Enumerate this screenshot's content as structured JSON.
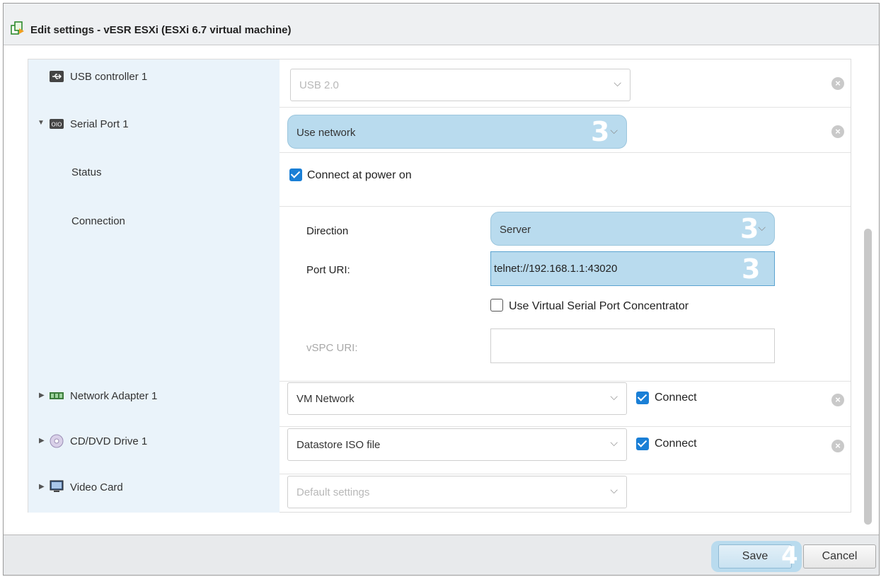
{
  "dialog": {
    "title": "Edit settings - vESR ESXi (ESXi 6.7 virtual machine)"
  },
  "rows": {
    "usb": {
      "label": "USB controller 1",
      "icon": "usb-icon",
      "select_value": "USB 2.0"
    },
    "serial": {
      "label": "Serial Port 1",
      "icon": "serial-port-icon",
      "select_value": "Use network",
      "badge": "3"
    },
    "status": {
      "label": "Status",
      "checkbox_label": "Connect at power on",
      "checked": true
    },
    "connection": {
      "label": "Connection",
      "direction_label": "Direction",
      "direction_value": "Server",
      "direction_badge": "3",
      "port_uri_label": "Port URI:",
      "port_uri_value": "telnet://192.168.1.1:43020",
      "port_uri_badge": "3",
      "vspc_checkbox_label": "Use Virtual Serial Port Concentrator",
      "vspc_checked": false,
      "vspc_uri_label": "vSPC URI:",
      "vspc_uri_value": ""
    },
    "network": {
      "label": "Network Adapter 1",
      "icon": "network-adapter-icon",
      "select_value": "VM Network",
      "connect_label": "Connect",
      "connect_checked": true
    },
    "cdrom": {
      "label": "CD/DVD Drive 1",
      "icon": "cd-dvd-icon",
      "select_value": "Datastore ISO file",
      "connect_label": "Connect",
      "connect_checked": true
    },
    "video": {
      "label": "Video Card",
      "icon": "monitor-icon",
      "select_value": "Default settings"
    }
  },
  "footer": {
    "save_label": "Save",
    "save_badge": "4",
    "cancel_label": "Cancel"
  },
  "colors": {
    "highlight": "#b9dbee",
    "label_column": "#eaf3fa",
    "checkbox": "#1a7fd6"
  }
}
